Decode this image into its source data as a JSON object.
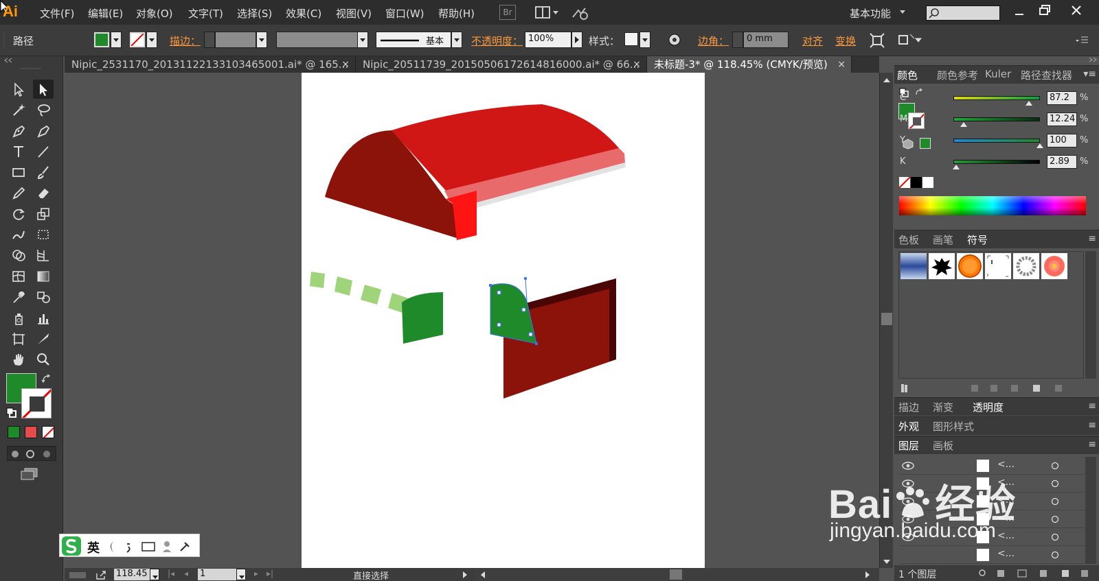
{
  "app": {
    "logo": "Ai",
    "workspace": "基本功能"
  },
  "menu": [
    "文件(F)",
    "编辑(E)",
    "对象(O)",
    "文字(T)",
    "选择(S)",
    "效果(C)",
    "视图(V)",
    "窗口(W)",
    "帮助(H)"
  ],
  "menubar_icons": {
    "bridge": "Br"
  },
  "control": {
    "object_type": "路径",
    "stroke_label": "描边：",
    "stroke_style": "基本",
    "opacity_label": "不透明度：",
    "opacity_value": "100%",
    "style_label": "样式：",
    "corner_label": "边角：",
    "corner_value": "0 mm",
    "align_label": "对齐",
    "transform_label": "变换",
    "fill_color": "#1f8a2a"
  },
  "tabs": [
    {
      "label": "Nipic_2531170_20131122133103465001.ai* @ 165...",
      "active": false
    },
    {
      "label": "Nipic_20511739_20150506172614816000.ai* @ 66...",
      "active": false
    },
    {
      "label": "未标题-3* @ 118.45% (CMYK/预览)",
      "active": true
    }
  ],
  "status": {
    "zoom": "118.45",
    "page": "1",
    "tool": "直接选择"
  },
  "color_panel": {
    "tabs": [
      "颜色",
      "颜色参考",
      "Kuler",
      "路径查找器"
    ],
    "sliders": [
      {
        "label": "C",
        "value": "87.2",
        "fraction": 0.872
      },
      {
        "label": "M",
        "value": "12.24",
        "fraction": 0.1224
      },
      {
        "label": "Y",
        "value": "100",
        "fraction": 1.0
      },
      {
        "label": "K",
        "value": "2.89",
        "fraction": 0.0289
      }
    ],
    "percent_sign": "%"
  },
  "swatch_panel": {
    "tabs": [
      "色板",
      "画笔",
      "符号"
    ]
  },
  "transparency_panel": {
    "tabs": [
      "描边",
      "渐变",
      "透明度"
    ]
  },
  "appearance_panel": {
    "tabs": [
      "外观",
      "图形样式"
    ]
  },
  "layers_panel": {
    "tabs": [
      "图层",
      "画板"
    ],
    "rows": [
      "<...",
      "<...",
      "<...",
      "<...",
      "<...",
      "<..."
    ],
    "footer": "1 个图层"
  },
  "ime_bar": {
    "lang": "英"
  },
  "watermark": {
    "line1": "Bai",
    "line1b": "经验",
    "line2": "jingyan.baidu.com"
  },
  "colors": {
    "canvas_green": "#1f8a2a",
    "light_green": "#9fd47a",
    "dark_red": "#8b1309",
    "red": "#d11616"
  }
}
